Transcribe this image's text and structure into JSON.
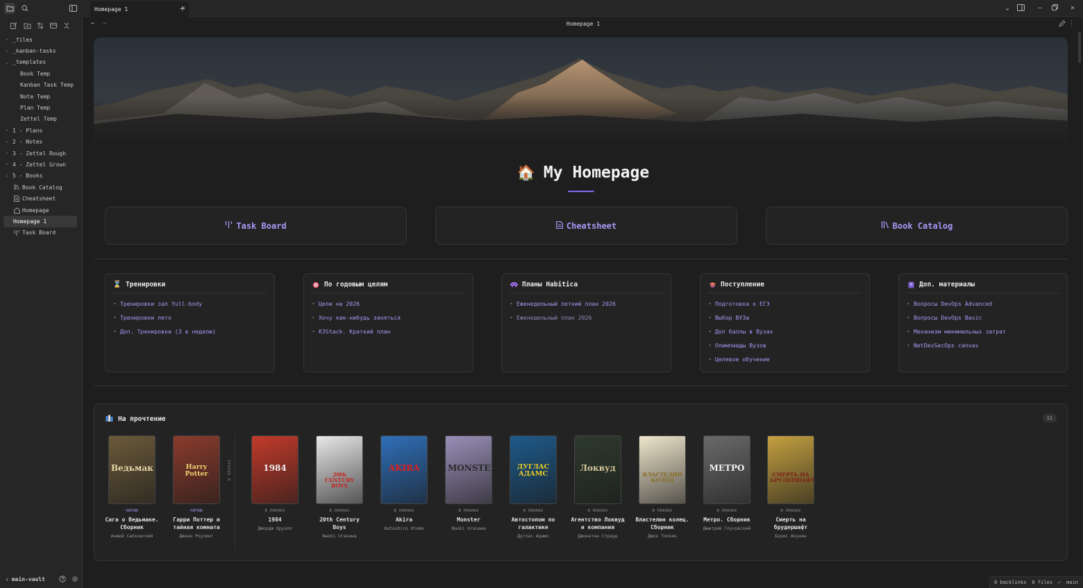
{
  "app": {
    "tab_title": "Homepage 1",
    "view_title": "Homepage 1"
  },
  "sidebar": {
    "tree": [
      {
        "label": "_files",
        "kind": "folder",
        "open": false
      },
      {
        "label": "_kanban-tasks",
        "kind": "folder",
        "open": false
      },
      {
        "label": "_templates",
        "kind": "folder",
        "open": true
      },
      {
        "label": "Book Temp",
        "kind": "child"
      },
      {
        "label": "Kanban Task Temp",
        "kind": "child"
      },
      {
        "label": "Note Temp",
        "kind": "child"
      },
      {
        "label": "Plan Temp",
        "kind": "child"
      },
      {
        "label": "Zettel Temp",
        "kind": "child"
      },
      {
        "label": "1 - Plans",
        "kind": "folder",
        "open": false
      },
      {
        "label": "2 - Notes",
        "kind": "folder",
        "open": false
      },
      {
        "label": "3 - Zettel Rough",
        "kind": "folder",
        "open": false
      },
      {
        "label": "4 - Zettel Grown",
        "kind": "folder",
        "open": false
      },
      {
        "label": "5 - Books",
        "kind": "folder",
        "open": false
      },
      {
        "label": "Book Catalog",
        "kind": "file",
        "icon": "library-icon"
      },
      {
        "label": "Cheatsheet",
        "kind": "file",
        "icon": "file-text-icon"
      },
      {
        "label": "Homepage",
        "kind": "file",
        "icon": "home-icon"
      },
      {
        "label": "Homepage 1",
        "kind": "active"
      },
      {
        "label": "Task Board",
        "kind": "file",
        "icon": "kanban-icon"
      }
    ],
    "vault_name": "main-vault"
  },
  "page": {
    "title": "My Homepage",
    "title_emoji": "🏠"
  },
  "quick_links": [
    {
      "label": "Task Board",
      "icon": "kanban-icon"
    },
    {
      "label": "Cheatsheet",
      "icon": "file-text-icon"
    },
    {
      "label": "Book Catalog",
      "icon": "library-icon"
    }
  ],
  "cards": [
    {
      "title": "Тренировки",
      "icon": "hourglass-icon",
      "items": [
        "Тренировки зал full-body",
        "Тренировки лето",
        "Доп. Тренировки (3 в неделю)"
      ]
    },
    {
      "title": "По годовым целям",
      "icon": "target-icon",
      "items": [
        "Цели на 2026",
        "Хочу как-нибудь заняться",
        "K3Stack. Краткий план"
      ]
    },
    {
      "title": "Планы Habitica",
      "icon": "alien-icon",
      "items": [
        "Еженедельный летний план 2026",
        "Еженедельный план 2026"
      ]
    },
    {
      "title": "Поступление",
      "icon": "graduation-icon",
      "items": [
        "Подготовка к ЕГЭ",
        "Выбор ВУЗа",
        "Доп баллы в Вузах",
        "Олимпиады Вузов",
        "Целевое обучение"
      ]
    },
    {
      "title": "Доп. материалы",
      "icon": "book-icon",
      "items": [
        "Вопросы DevOps Advanced",
        "Вопросы DevOps Basic",
        "Механизм минимальных затрат",
        "NetDevSecOps canvas"
      ]
    }
  ],
  "reading": {
    "title": "На прочтение",
    "count": "11",
    "planned_vertical_label": "В ПЛАНАХ",
    "books": [
      {
        "status": "ЧИТАЮ",
        "title": "Сага о Ведьмаке. Сборник",
        "author": "Анжей Сапковский",
        "cover_text": "Ведьмак",
        "cover_bg": "#6b5a3a",
        "cover_fg": "#e8d8a8"
      },
      {
        "status": "ЧИТАЮ",
        "title": "Гарри Поттер и тайная комната",
        "author": "Джоан Роулинг",
        "cover_text": "Harry Potter",
        "cover_bg": "#8a3b2c",
        "cover_fg": "#f2d070"
      },
      {
        "status": "В ПЛАНАХ",
        "title": "1984",
        "author": "Джордж Оруэлл",
        "cover_text": "1984",
        "cover_bg": "#c23a2a",
        "cover_fg": "#f0f0f0"
      },
      {
        "status": "В ПЛАНАХ",
        "title": "20th Century Boys",
        "author": "Naoki Urasawa",
        "cover_text": "20th CENTURY BOYS",
        "cover_bg": "#e8e8e8",
        "cover_fg": "#c4201a"
      },
      {
        "status": "В ПЛАНАХ",
        "title": "Akira",
        "author": "Katsuhiro Otomo",
        "cover_text": "AKIRA",
        "cover_bg": "#2f6fb8",
        "cover_fg": "#e02020"
      },
      {
        "status": "В ПЛАНАХ",
        "title": "Monster",
        "author": "Naoki Urasawa",
        "cover_text": "MONSTER",
        "cover_bg": "#9a8fb8",
        "cover_fg": "#2a2a2a"
      },
      {
        "status": "В ПЛАНАХ",
        "title": "Автостопом по галактике",
        "author": "Дуглас Адамс",
        "cover_text": "ДУГЛАС АДАМС",
        "cover_bg": "#1e5a8a",
        "cover_fg": "#f2d020"
      },
      {
        "status": "В ПЛАНАХ",
        "title": "Агентство Локвуд и компания",
        "author": "Джонатан Страуд",
        "cover_text": "Локвуд",
        "cover_bg": "#2e3a2e",
        "cover_fg": "#d8c89a"
      },
      {
        "status": "В ПЛАНАХ",
        "title": "Властелин колец. Сборник",
        "author": "Джон Толкин",
        "cover_text": "ВЛАСТЕЛИН КОЛЕЦ",
        "cover_bg": "#efe6cc",
        "cover_fg": "#8a6a20"
      },
      {
        "status": "В ПЛАНАХ",
        "title": "Метро. Сборник",
        "author": "Дмитрий Глуховский",
        "cover_text": "МЕТРО",
        "cover_bg": "#6a6a6a",
        "cover_fg": "#f0f0f0"
      },
      {
        "status": "В ПЛАНАХ",
        "title": "Смерть на брудершафт",
        "author": "Борис Акунин",
        "cover_text": "СМЕРТЬ НА БРУДЕРШАФТ",
        "cover_bg": "#c4a040",
        "cover_fg": "#7a1e1a"
      }
    ]
  },
  "statusbar": {
    "backlinks": "0 backlinks",
    "files": "0 files",
    "branch": "main"
  },
  "colors": {
    "accent": "#a699f5",
    "background": "#1e1e1e",
    "panel": "#232323",
    "sidebar": "#262626"
  }
}
